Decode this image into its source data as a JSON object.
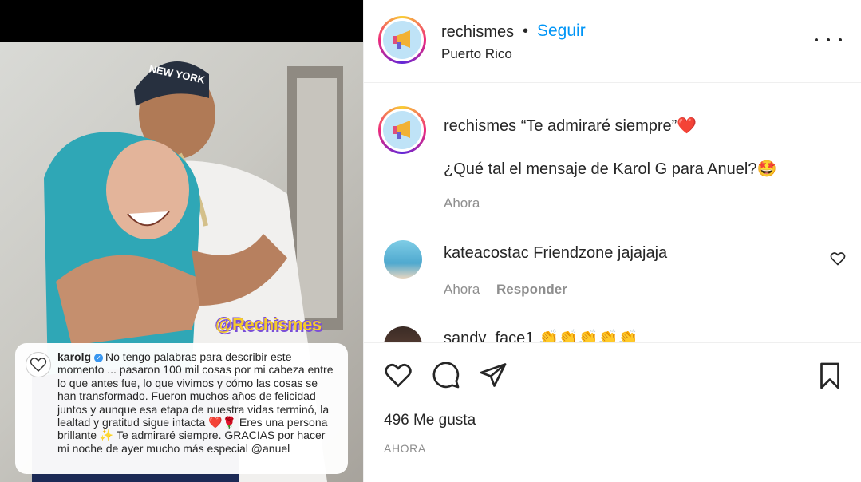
{
  "post": {
    "username": "rechismes",
    "follow_label": "Seguir",
    "location": "Puerto Rico",
    "more_label": "more-options",
    "watermark": "@Rechismes"
  },
  "quote_card": {
    "username": "karolg",
    "text": "No tengo palabras para describir este momento ... pasaron 100 mil cosas por mi cabeza entre lo que antes fue, lo que vivimos y cómo las cosas se han transformado. Fueron muchos años de felicidad juntos y aunque  esa etapa de nuestra vidas terminó, la lealtad y gratitud sigue intacta ❤️🌹 Eres una persona brillante ✨ Te admiraré siempre. GRACIAS por hacer mi noche de ayer mucho más especial @anuel"
  },
  "caption": {
    "username": "rechismes",
    "line1": "“Te admiraré siempre”❤️",
    "line2": "¿Qué tal el mensaje de Karol G para Anuel?🤩",
    "time": "Ahora"
  },
  "comments": [
    {
      "username": "kateacostac",
      "text": "Friendzone jajajaja",
      "time": "Ahora",
      "reply_label": "Responder"
    },
    {
      "username": "sandy_face1",
      "text": "👏👏👏👏👏"
    }
  ],
  "footer": {
    "likes_count": "496",
    "likes_label": "Me gusta",
    "time_ago": "AHORA"
  },
  "colors": {
    "accent": "#0095f6",
    "muted": "#8e8e8e",
    "text": "#262626"
  },
  "icons": [
    "heart-icon",
    "comment-icon",
    "share-icon",
    "bookmark-icon",
    "more-options-icon",
    "verified-icon",
    "like-comment-heart-icon"
  ]
}
